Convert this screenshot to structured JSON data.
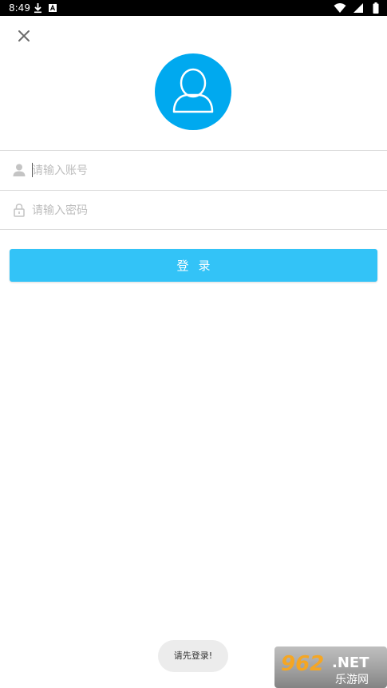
{
  "status_bar": {
    "time": "8:49",
    "icons": [
      "download-icon",
      "a-notification-icon",
      "wifi-icon",
      "signal-icon",
      "battery-icon"
    ]
  },
  "header": {
    "close_icon": "close-icon"
  },
  "avatar": {
    "icon": "user-avatar-icon",
    "color": "#00a9ef"
  },
  "form": {
    "account": {
      "icon": "person-icon",
      "placeholder": "请输入账号",
      "value": ""
    },
    "password": {
      "icon": "lock-icon",
      "placeholder": "请输入密码",
      "value": ""
    },
    "login_label": "登录",
    "login_color": "#33c3f7"
  },
  "toast": {
    "message": "请先登录!"
  },
  "watermark": {
    "brand": "962.NET",
    "subtitle": "乐游网"
  }
}
